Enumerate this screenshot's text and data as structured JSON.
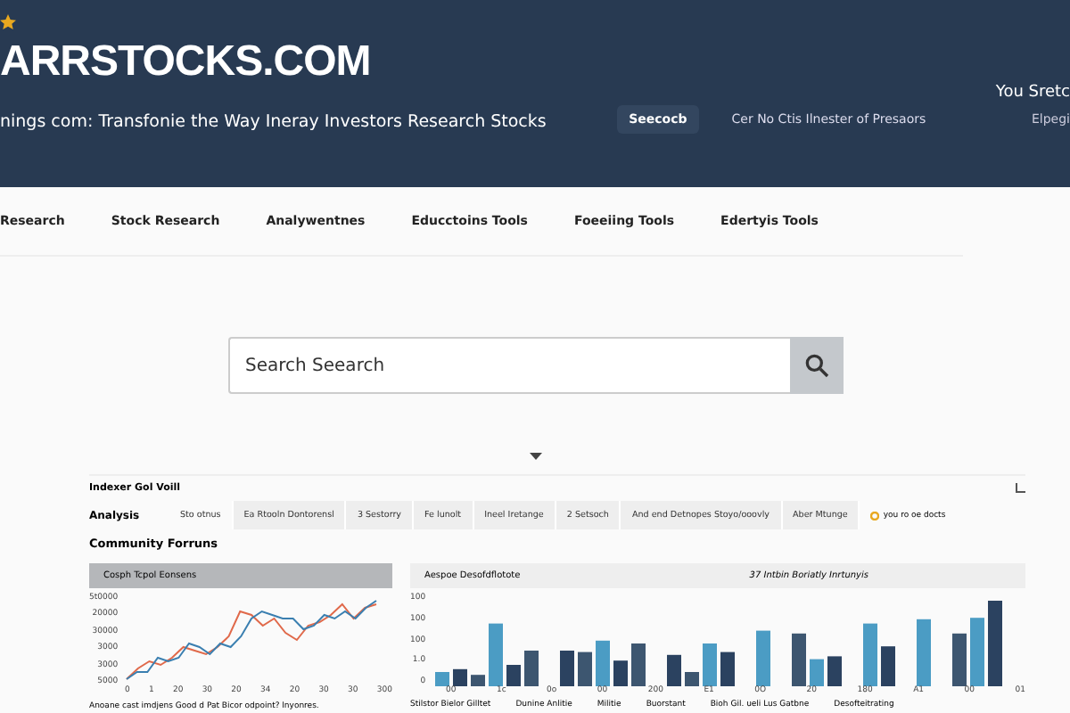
{
  "header": {
    "logo": "ARRSTOCKS.COM",
    "tagline": "nings com: Transfonie the Way Ineray Investors Research Stocks",
    "search_button": "Seecocb",
    "link": "Cer No Ctis Ilnester of Presaors",
    "user": "You Sretc",
    "user_sub": "Elpegi"
  },
  "nav": {
    "items": [
      {
        "label": "Research",
        "selected": false
      },
      {
        "label": "Stock Research",
        "selected": false
      },
      {
        "label": "Analywentnes",
        "selected": false
      },
      {
        "label": "Educctoins Tools",
        "selected": false
      },
      {
        "label": "Foeeiing Tools",
        "selected": false
      },
      {
        "label": "Edertyis Tools",
        "selected": false
      }
    ]
  },
  "search": {
    "value": "Search Seearch"
  },
  "section": {
    "title": "Indexer Gol Voill",
    "row_label": "Analysis",
    "tabs": [
      {
        "label": "Sto otnus",
        "selected": true
      },
      {
        "label": "Ea Rtooln Dontorensl",
        "selected": false
      },
      {
        "label": "3 Sestorry",
        "selected": false
      },
      {
        "label": "Fe lunolt",
        "selected": false
      },
      {
        "label": "Ineel Iretange",
        "selected": false
      },
      {
        "label": "2 Setsoch",
        "selected": false
      },
      {
        "label": "And end Detnopes Stoyo/ooovly",
        "selected": false
      },
      {
        "label": "Aber Mtunge",
        "selected": false
      }
    ],
    "note": "you ro oe docts",
    "subtitle": "Community Forruns"
  },
  "line_panel": {
    "title": "Cosph Tcpol Eonsens",
    "y_labels": [
      "5t0000",
      "20000",
      "30000",
      "3000",
      "3000",
      "5000"
    ],
    "x_labels": [
      "0",
      "1",
      "20",
      "30",
      "20",
      "34",
      "20",
      "30",
      "30",
      "300"
    ],
    "caption": "Anoane cast imdjens Good d Pat Bicor odpoint? lnyonres."
  },
  "bar_panel": {
    "title": "Aespoe Desofdflotote",
    "subtitle": "37 Intbin Boriatly Inrtunyis",
    "y_labels": [
      "100",
      "100",
      "100",
      "1.0",
      "0"
    ],
    "x_labels": [
      "00",
      "1c",
      "0o",
      "00",
      "200",
      "E1",
      "0O",
      "20",
      "180",
      "A1",
      "00",
      "01"
    ],
    "legend": [
      "Stilstor Bielor Gilltet",
      "Dunine Anlitie",
      "Militie",
      "Buorstant",
      "Bioh Gil. ueli Lus Gatbne",
      "Desofteitrating"
    ]
  }
}
